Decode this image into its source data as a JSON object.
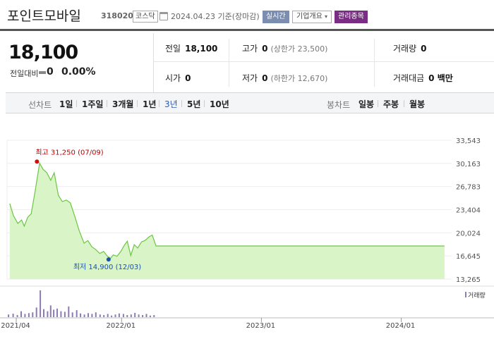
{
  "header": {
    "stock_name": "포인트모바일",
    "stock_code": "318020",
    "market": "코스닥",
    "date": "2024.04.23",
    "date_suffix": "기준(장마감)",
    "realtime_label": "실시간",
    "company_label": "기업개요",
    "managed_label": "관리종목"
  },
  "price": {
    "current": "18,100",
    "change_label": "전일대비",
    "change_value": "0",
    "change_pct": "0.00%"
  },
  "stats": {
    "prev_label": "전일",
    "prev_value": "18,100",
    "high_label": "고가",
    "high_value": "0",
    "high_sub": "(상한가 23,500)",
    "volume_label": "거래량",
    "volume_value": "0",
    "open_label": "시가",
    "open_value": "0",
    "low_label": "저가",
    "low_value": "0",
    "low_sub": "(하한가 12,670)",
    "amount_label": "거래대금",
    "amount_value": "0 백만"
  },
  "toolbar": {
    "line_label": "선차트",
    "line_periods": [
      "1일",
      "1주일",
      "3개월",
      "1년",
      "3년",
      "5년",
      "10년"
    ],
    "active_period": "3년",
    "candle_label": "봉차트",
    "candle_periods": [
      "일봉",
      "주봉",
      "월봉"
    ]
  },
  "chart_data": {
    "type": "area",
    "y_ticks": [
      "33,543",
      "30,163",
      "26,783",
      "23,404",
      "20,024",
      "16,645",
      "13,265"
    ],
    "ylim": [
      13265,
      33543
    ],
    "x_ticks": [
      "2021/04",
      "2022/01",
      "2023/01",
      "2024/01"
    ],
    "high_annotation": "최고 31,250 (07/09)",
    "low_annotation": "최저 14,900 (12/03)",
    "volume_label": "거래량",
    "line_color": "#6cc644",
    "fill_color": "#d9f5c8",
    "price_series": [
      [
        "2021-03-15",
        24300
      ],
      [
        "2021-03-25",
        22500
      ],
      [
        "2021-04-05",
        21400
      ],
      [
        "2021-04-15",
        21900
      ],
      [
        "2021-04-22",
        21000
      ],
      [
        "2021-05-01",
        22300
      ],
      [
        "2021-05-10",
        22800
      ],
      [
        "2021-05-20",
        26000
      ],
      [
        "2021-06-01",
        30200
      ],
      [
        "2021-06-10",
        29300
      ],
      [
        "2021-06-20",
        28800
      ],
      [
        "2021-06-30",
        27700
      ],
      [
        "2021-07-09",
        28800
      ],
      [
        "2021-07-20",
        25500
      ],
      [
        "2021-07-30",
        24600
      ],
      [
        "2021-08-10",
        24800
      ],
      [
        "2021-08-20",
        24400
      ],
      [
        "2021-09-01",
        22400
      ],
      [
        "2021-09-12",
        20400
      ],
      [
        "2021-09-25",
        18500
      ],
      [
        "2021-10-05",
        18900
      ],
      [
        "2021-10-15",
        18000
      ],
      [
        "2021-10-25",
        17600
      ],
      [
        "2021-11-05",
        17000
      ],
      [
        "2021-11-15",
        17300
      ],
      [
        "2021-11-25",
        16600
      ],
      [
        "2021-12-03",
        16300
      ],
      [
        "2021-12-10",
        16800
      ],
      [
        "2021-12-20",
        16600
      ],
      [
        "2021-12-30",
        17300
      ],
      [
        "2022-01-08",
        18200
      ],
      [
        "2022-01-16",
        18800
      ],
      [
        "2022-01-25",
        16700
      ],
      [
        "2022-02-03",
        18300
      ],
      [
        "2022-02-12",
        17800
      ],
      [
        "2022-02-22",
        18700
      ],
      [
        "2022-03-03",
        18900
      ],
      [
        "2022-03-13",
        19400
      ],
      [
        "2022-03-22",
        19700
      ],
      [
        "2022-04-01",
        18100
      ],
      [
        "2024-04-23",
        18100
      ]
    ],
    "volume_series": [
      [
        "2021-03-10",
        0.1
      ],
      [
        "2021-03-22",
        0.13
      ],
      [
        "2021-04-02",
        0.08
      ],
      [
        "2021-04-12",
        0.22
      ],
      [
        "2021-04-22",
        0.12
      ],
      [
        "2021-05-02",
        0.15
      ],
      [
        "2021-05-12",
        0.18
      ],
      [
        "2021-05-22",
        0.36
      ],
      [
        "2021-06-01",
        1.0
      ],
      [
        "2021-06-10",
        0.3
      ],
      [
        "2021-06-20",
        0.22
      ],
      [
        "2021-06-28",
        0.44
      ],
      [
        "2021-07-06",
        0.28
      ],
      [
        "2021-07-15",
        0.32
      ],
      [
        "2021-07-25",
        0.22
      ],
      [
        "2021-08-04",
        0.2
      ],
      [
        "2021-08-14",
        0.4
      ],
      [
        "2021-08-24",
        0.18
      ],
      [
        "2021-09-04",
        0.26
      ],
      [
        "2021-09-14",
        0.14
      ],
      [
        "2021-09-24",
        0.1
      ],
      [
        "2021-10-04",
        0.15
      ],
      [
        "2021-10-14",
        0.12
      ],
      [
        "2021-10-24",
        0.18
      ],
      [
        "2021-11-04",
        0.1
      ],
      [
        "2021-11-14",
        0.08
      ],
      [
        "2021-11-24",
        0.12
      ],
      [
        "2021-12-04",
        0.06
      ],
      [
        "2021-12-14",
        0.1
      ],
      [
        "2021-12-24",
        0.14
      ],
      [
        "2022-01-04",
        0.12
      ],
      [
        "2022-01-14",
        0.08
      ],
      [
        "2022-01-24",
        0.1
      ],
      [
        "2022-02-03",
        0.16
      ],
      [
        "2022-02-13",
        0.1
      ],
      [
        "2022-02-23",
        0.08
      ],
      [
        "2022-03-05",
        0.12
      ],
      [
        "2022-03-15",
        0.06
      ],
      [
        "2022-03-25",
        0.08
      ]
    ]
  }
}
